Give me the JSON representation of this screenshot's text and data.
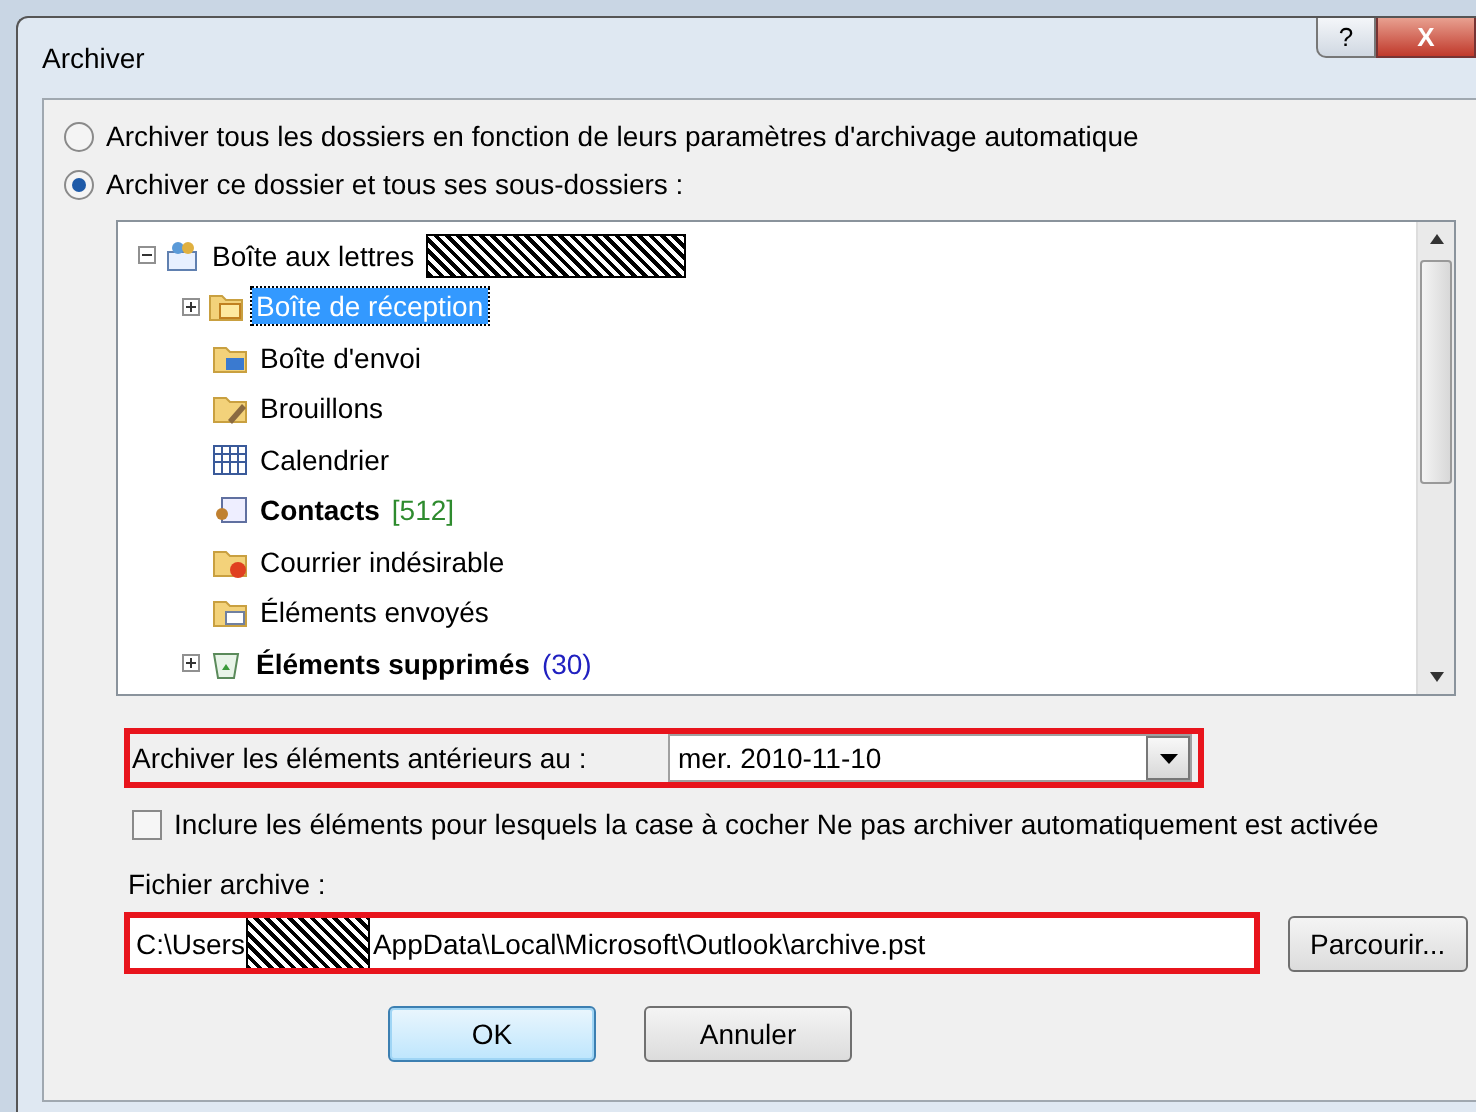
{
  "window": {
    "title": "Archiver",
    "help_label": "?",
    "close_label": "X"
  },
  "scope_options": [
    {
      "label": "Archiver tous les dossiers en fonction de leurs paramètres d'archivage automatique",
      "selected": false
    },
    {
      "label": "Archiver ce dossier et tous ses sous-dossiers :",
      "selected": true
    }
  ],
  "folder_tree": {
    "root": {
      "label": "Boîte aux lettres",
      "kind": "mailbox",
      "expanded": true,
      "redacted": true,
      "children": [
        {
          "label": "Boîte de réception",
          "kind": "inbox",
          "has_children": true,
          "selected": true,
          "bold": false
        },
        {
          "label": "Boîte d'envoi",
          "kind": "outbox",
          "has_children": false,
          "selected": false,
          "bold": false
        },
        {
          "label": "Brouillons",
          "kind": "drafts",
          "has_children": false,
          "selected": false,
          "bold": false
        },
        {
          "label": "Calendrier",
          "kind": "calendar",
          "has_children": false,
          "selected": false,
          "bold": false
        },
        {
          "label": "Contacts",
          "kind": "contacts",
          "has_children": false,
          "selected": false,
          "bold": true,
          "count": "[512]",
          "color": "#2e8b2e"
        },
        {
          "label": "Courrier indésirable",
          "kind": "junk",
          "has_children": false,
          "selected": false,
          "bold": false
        },
        {
          "label": "Éléments envoyés",
          "kind": "sent",
          "has_children": false,
          "selected": false,
          "bold": false
        },
        {
          "label": "Éléments supprimés",
          "kind": "deleted",
          "has_children": true,
          "selected": false,
          "bold": true,
          "count": "(30)",
          "color": "#2020c0"
        }
      ]
    }
  },
  "older_than": {
    "label": "Archiver les éléments antérieurs au :",
    "value": "mer. 2010-11-10",
    "highlighted": true
  },
  "include_checkbox": {
    "label": "Inclure les éléments pour lesquels la case à cocher Ne pas archiver automatiquement est activée",
    "checked": false
  },
  "archive_file": {
    "label": "Fichier archive :",
    "path_start": "C:\\Users",
    "path_end": "AppData\\Local\\Microsoft\\Outlook\\archive.pst",
    "redacted": true,
    "highlighted": true
  },
  "buttons": [
    {
      "label": "Parcourir...",
      "kind": "browse"
    },
    {
      "label": "OK",
      "kind": "default"
    },
    {
      "label": "Annuler",
      "kind": "normal"
    }
  ]
}
